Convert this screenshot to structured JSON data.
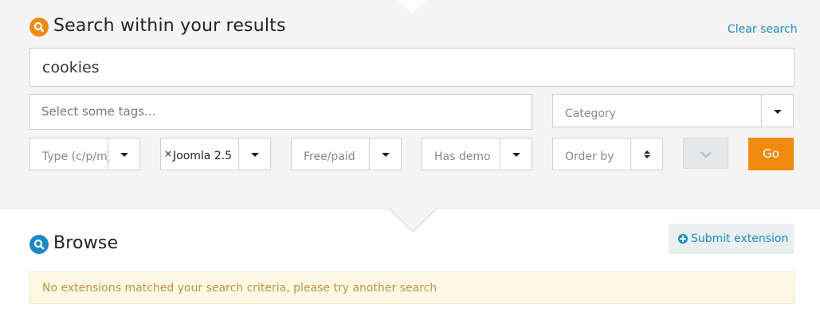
{
  "search_section": {
    "heading": "Search within your results",
    "clear_link": "Clear search",
    "query_value": "cookies",
    "tags_placeholder": "Select some tags...",
    "category_label": "Category",
    "filters": {
      "type": "Type (c/p/m)",
      "version_chip": "Joomla 2.5",
      "version_remove": "×",
      "free_paid": "Free/paid",
      "has_demo": "Has demo",
      "order_by": "Order by"
    },
    "go_label": "Go"
  },
  "browse_section": {
    "heading": "Browse",
    "submit_label": "Submit extension",
    "alert_message": "No extensions matched your search criteria, please try another search"
  },
  "colors": {
    "search_icon": "#f28a10",
    "browse_icon": "#1a8ac2",
    "accent_link": "#1a8ac2",
    "go_button": "#f28a10",
    "alert_text": "#c09348"
  },
  "icons": {
    "search_heading": "search-icon",
    "browse_heading": "search-icon",
    "submit": "plus-circle-icon",
    "dropdown": "caret-down-icon",
    "order": "sort-icon",
    "disabled": "chevron-down-icon"
  }
}
